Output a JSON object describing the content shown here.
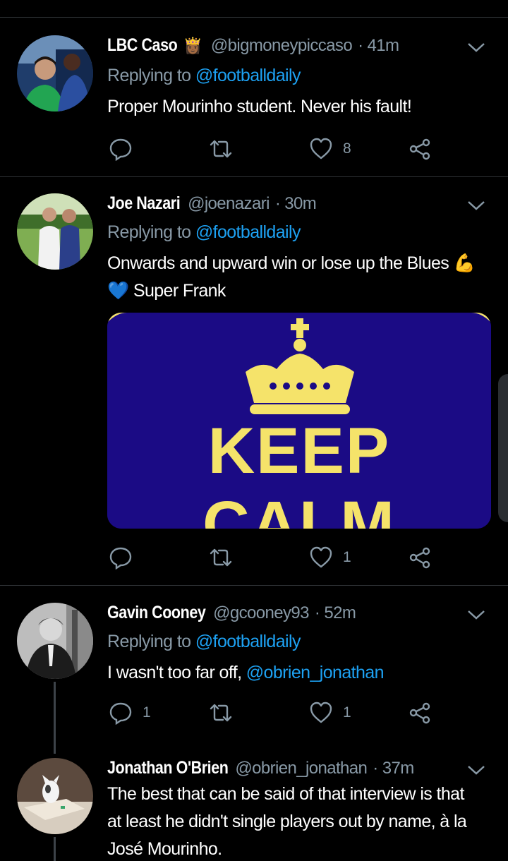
{
  "tweets": [
    {
      "name": "LBC Caso",
      "name_emoji": "👸🏾",
      "handle": "@bigmoneypiccaso",
      "time": "· 41m",
      "replying_prefix": "Replying to ",
      "replying_to": "@footballdaily",
      "text": "Proper Mourinho student. Never his fault!",
      "replies": "",
      "retweets": "",
      "likes": "8"
    },
    {
      "name": "Joe Nazari",
      "handle": "@joenazari",
      "time": "· 30m",
      "replying_prefix": "Replying to ",
      "replying_to": "@footballdaily",
      "text_line1": "Onwards and upward win or lose up the Blues 💪",
      "text_line2": "💙 Super Frank",
      "media_text1": "KEEP",
      "media_text2": "CALM",
      "replies": "",
      "retweets": "",
      "likes": "1"
    },
    {
      "name": "Gavin Cooney",
      "handle": "@gcooney93",
      "time": "· 52m",
      "replying_prefix": "Replying to ",
      "replying_to": "@footballdaily",
      "text": "I wasn't too far off, ",
      "text_mention": "@obrien_jonathan",
      "replies": "1",
      "retweets": "",
      "likes": "1"
    },
    {
      "name": "Jonathan O'Brien",
      "handle": "@obrien_jonathan",
      "time": "· 37m",
      "text_line1": "The best that can be said of that interview is that",
      "text_line2": "at least he didn't single players out by name, à la",
      "text_line3": "José Mourinho."
    }
  ],
  "colors": {
    "background": "#000000",
    "link": "#1da1f2",
    "muted": "#8899a6",
    "separator": "#2f3336",
    "media_bg": "#1b0b85",
    "media_text": "#f5e36a"
  }
}
